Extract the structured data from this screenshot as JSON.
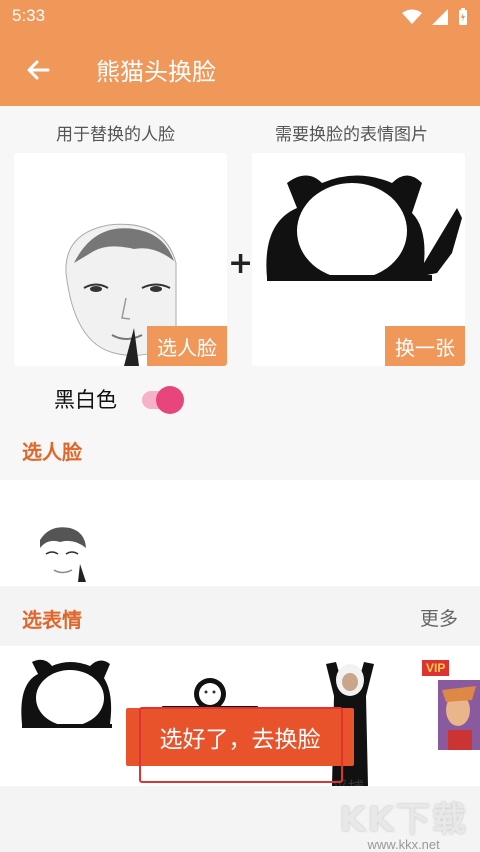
{
  "status_bar": {
    "time": "5:33"
  },
  "toolbar": {
    "title": "熊猫头换脸"
  },
  "compare": {
    "left_label": "用于替换的人脸",
    "right_label": "需要换脸的表情图片",
    "plus": "+",
    "select_face_button": "选人脸",
    "change_button": "换一张"
  },
  "bw_toggle": {
    "label": "黑白色",
    "on": true
  },
  "sections": {
    "select_face": "选人脸",
    "select_expression": "选表情",
    "more": "更多"
  },
  "expressions": {
    "vip_badge": "VIP",
    "caption_partial": "…采捕…"
  },
  "cta": {
    "label": "选好了，去换脸"
  },
  "watermark": {
    "big": "KK下载",
    "small": "www.kkx.net"
  },
  "colors": {
    "accent": "#f0975a",
    "section_title": "#e0662c",
    "cta": "#e8532c",
    "switch_on": "#e8457c"
  }
}
